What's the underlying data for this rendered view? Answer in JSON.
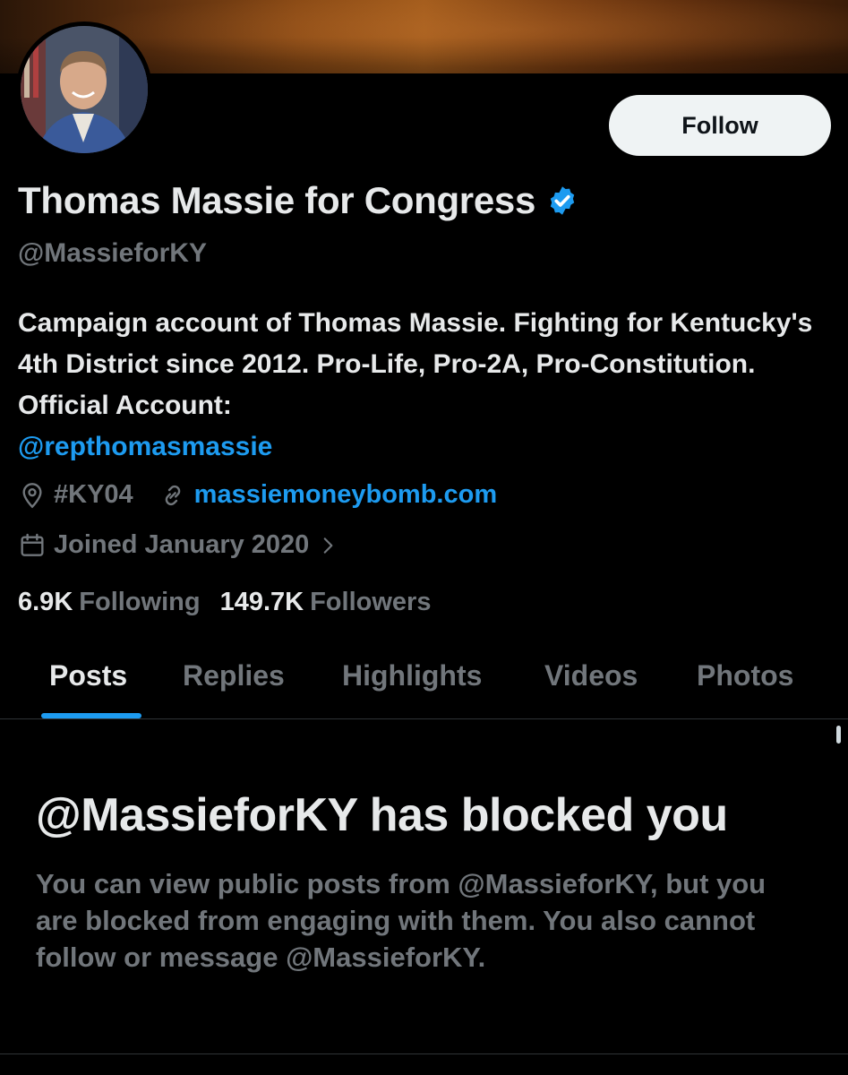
{
  "profile": {
    "display_name": "Thomas Massie for Congress",
    "handle": "@MassieforKY",
    "bio_text": "Campaign account of Thomas Massie. Fighting for Kentucky's 4th District since 2012. Pro-Life, Pro-2A, Pro-Constitution. Official Account:",
    "bio_mention": "@repthomasmassie",
    "location": "#KY04",
    "website": "massiemoneybomb.com",
    "joined": "Joined January 2020",
    "following_count": "6.9K",
    "following_label": "Following",
    "followers_count": "149.7K",
    "followers_label": "Followers",
    "verified_color": "#1d9bf0"
  },
  "actions": {
    "follow_label": "Follow"
  },
  "tabs": [
    {
      "label": "Posts",
      "active": true
    },
    {
      "label": "Replies",
      "active": false
    },
    {
      "label": "Highlights",
      "active": false
    },
    {
      "label": "Videos",
      "active": false
    },
    {
      "label": "Photos",
      "active": false
    }
  ],
  "blocked": {
    "title": "@MassieforKY has blocked you",
    "message": "You can view public posts from @MassieforKY, but you are blocked from engaging with them. You also cannot follow or message @MassieforKY."
  },
  "icons": [
    "verified-badge-icon",
    "location-pin-icon",
    "link-icon",
    "calendar-icon",
    "chevron-right-icon"
  ],
  "colors": {
    "accent": "#1d9bf0",
    "background": "#000000",
    "muted": "#71767b",
    "text": "#e7e9ea"
  }
}
